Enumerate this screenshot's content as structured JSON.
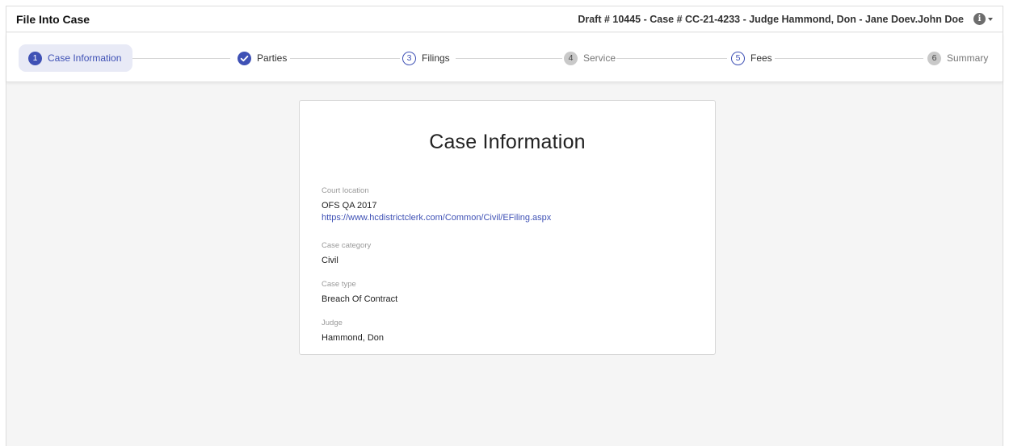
{
  "header": {
    "title": "File Into Case",
    "case_summary": "Draft # 10445 - Case # CC-21-4233 - Judge Hammond, Don - Jane Doev.John Doe",
    "info_icon": "info-circle-icon"
  },
  "stepper": {
    "steps": [
      {
        "number": "1",
        "label": "Case Information",
        "state": "active"
      },
      {
        "number": "",
        "label": "Parties",
        "state": "completed"
      },
      {
        "number": "3",
        "label": "Filings",
        "state": "available"
      },
      {
        "number": "4",
        "label": "Service",
        "state": "disabled"
      },
      {
        "number": "5",
        "label": "Fees",
        "state": "available"
      },
      {
        "number": "6",
        "label": "Summary",
        "state": "disabled"
      }
    ]
  },
  "card": {
    "title": "Case Information",
    "court_location": {
      "label": "Court location",
      "value": "OFS QA 2017",
      "link": "https://www.hcdistrictclerk.com/Common/Civil/EFiling.aspx"
    },
    "case_category": {
      "label": "Case category",
      "value": "Civil"
    },
    "case_type": {
      "label": "Case type",
      "value": "Breach Of Contract"
    },
    "judge": {
      "label": "Judge",
      "value": "Hammond, Don"
    }
  },
  "colors": {
    "accent": "#3f51b5",
    "active_step_bg": "#e8eaf6",
    "disabled_step": "#c9c9c9",
    "background": "#f5f5f5"
  }
}
